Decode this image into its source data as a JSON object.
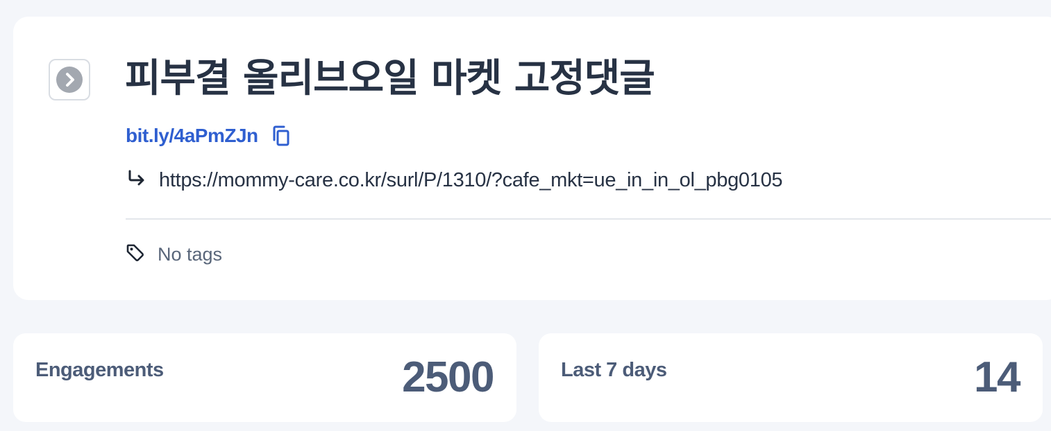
{
  "link": {
    "title": "피부결 올리브오일 마켓 고정댓글",
    "short_url": "bit.ly/4aPmZJn",
    "destination_url": "https://mommy-care.co.kr/surl/P/1310/?cafe_mkt=ue_in_in_ol_pbg0105",
    "tags_text": "No tags"
  },
  "stats": [
    {
      "label": "Engagements",
      "value": "2500"
    },
    {
      "label": "Last 7 days",
      "value": "14"
    }
  ],
  "icons": {
    "expand": "chevron-right-circle-icon",
    "copy": "copy-icon",
    "redirect": "redirect-arrow-icon",
    "tag": "tag-icon"
  },
  "colors": {
    "link_blue": "#2f5fd0",
    "title": "#273244",
    "stat_text": "#4c5c78",
    "background": "#f4f6fa"
  }
}
